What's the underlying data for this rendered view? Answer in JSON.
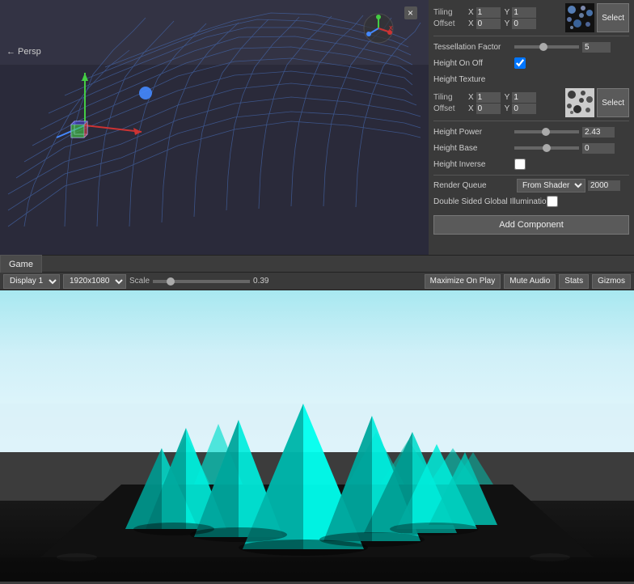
{
  "scene": {
    "persp_label": "← Persp"
  },
  "panel": {
    "tiling_label": "Tiling",
    "offset_label": "Offset",
    "tiling_x1": "1",
    "tiling_y1": "1",
    "offset_x1": "0",
    "offset_y1": "0",
    "select_label": "Select",
    "tessellation_label": "Tessellation Factor",
    "tessellation_value": "5",
    "height_on_off_label": "Height On Off",
    "height_texture_label": "Height Texture",
    "tiling_x2": "1",
    "tiling_y2": "1",
    "offset_x2": "0",
    "offset_y2": "0",
    "select2_label": "Select",
    "height_power_label": "Height Power",
    "height_power_value": "2.43",
    "height_base_label": "Height Base",
    "height_base_value": "0",
    "height_inverse_label": "Height Inverse",
    "render_queue_label": "Render Queue",
    "render_queue_option": "From Shader",
    "render_queue_value": "2000",
    "double_sided_label": "Double Sided Global Illuminatio",
    "add_component_label": "Add Component"
  },
  "game_bar": {
    "tab_label": "Game"
  },
  "bottom_bar": {
    "display_label": "Display 1",
    "resolution": "1920x1080",
    "scale_label": "Scale",
    "scale_value": "0.39",
    "maximize_label": "Maximize On Play",
    "mute_label": "Mute Audio",
    "stats_label": "Stats",
    "gizmos_label": "Gizmos"
  }
}
